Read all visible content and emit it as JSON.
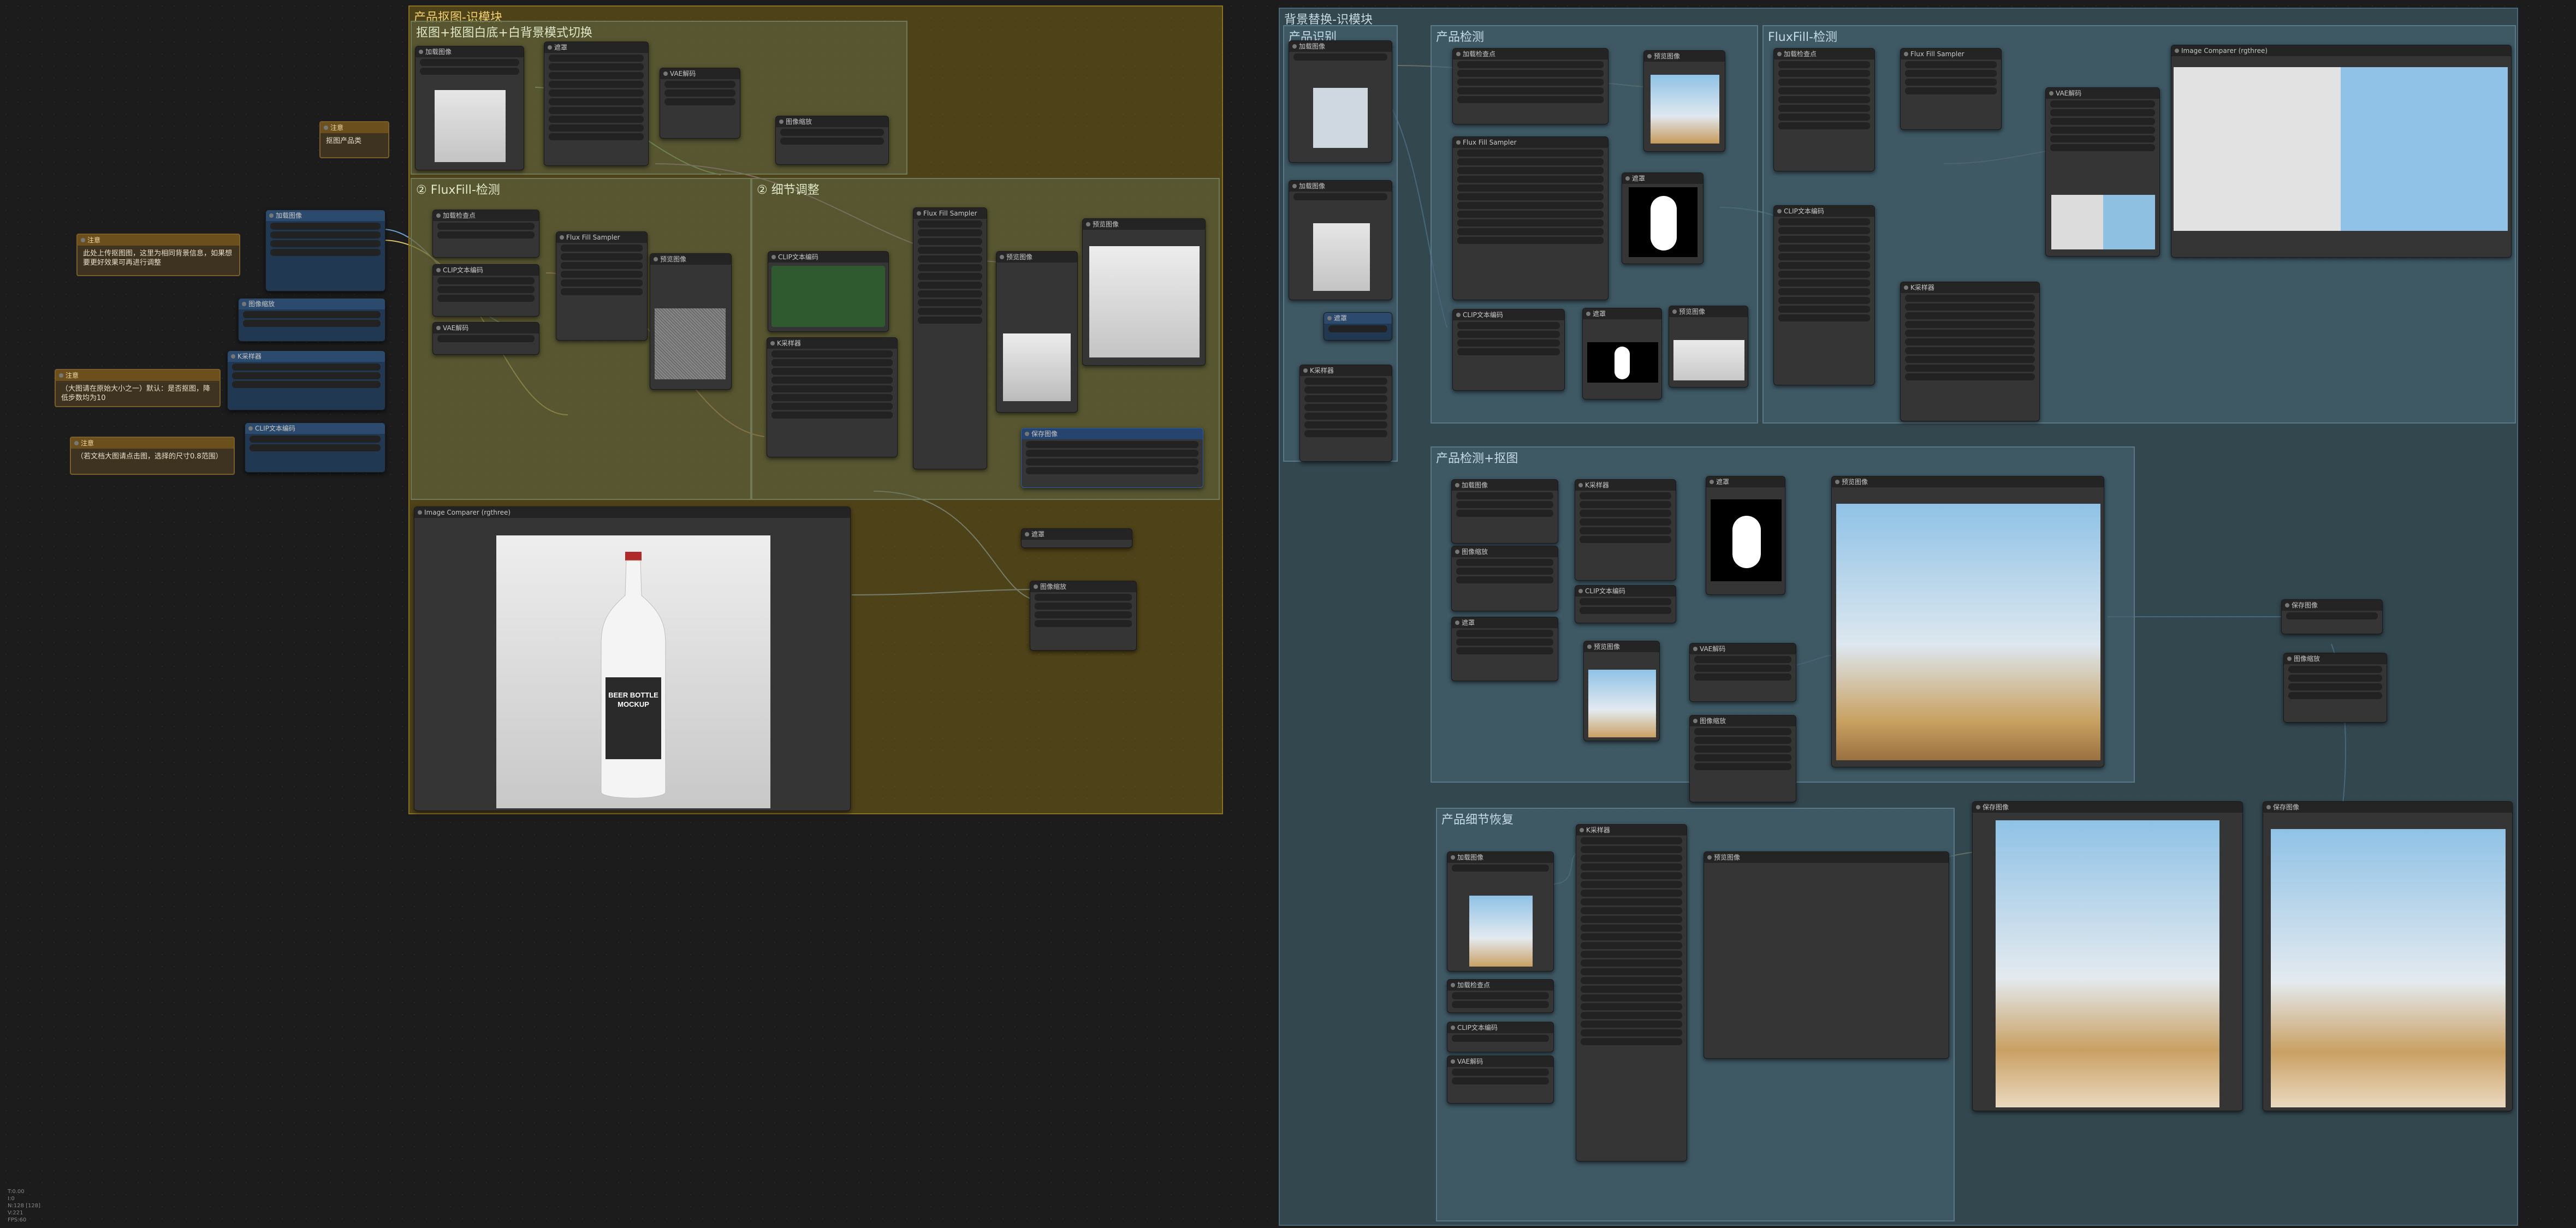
{
  "groups": {
    "product_matting": "产品抠图-识模块",
    "product_matting_sub1": "抠图+抠图白底+白背景模式切换",
    "product_matting_sub2": "② FluxFill-检测",
    "product_matting_sub3": "② 细节调整",
    "bg_replace": "背景替换-识模块",
    "bg_replace_sub1": "产品识别",
    "bg_replace_sub2": "产品检测",
    "bg_replace_sub3": "FluxFill-检测",
    "bg_replace_sub4": "产品检测+抠图",
    "bg_replace_sub5": "产品细节恢复"
  },
  "notes": [
    {
      "title": "注意",
      "text": "抠图产品类"
    },
    {
      "title": "注意",
      "text": "此处上传抠图图，这里为相同背景信息，如果想要更好效果可再进行调整"
    },
    {
      "title": "注意",
      "text": "（大图请在原始大小之一）默认：是否抠图，降低步数均为10"
    },
    {
      "title": "注意",
      "text": "（若文档大图请点击图，选择的尺寸0.8范围）"
    }
  ],
  "nodes": {
    "load_image": "加载图像",
    "preview_image": "预览图像",
    "compare_image": "Image Comparer (rgthree)",
    "flux_sampler": "Flux Fill Sampler",
    "clip_text": "CLIP文本编码",
    "vae_decode": "VAE解码",
    "mask_node": "遮罩",
    "resize": "图像缩放",
    "load_checkpoint": "加载检查点",
    "ksampler": "K采样器",
    "save_image": "保存图像"
  },
  "poster": {
    "line1": "BEER BOTTLE",
    "line2": "MOCKUP"
  },
  "sidebar": {
    "lines": [
      "T:0.00",
      "I:0",
      "N:128 [128]",
      "V:221",
      "FPS:60"
    ]
  },
  "colors": {
    "product_group": "#7a6318",
    "bg_group": "#3b5560",
    "canvas": "#1c1c1c"
  }
}
